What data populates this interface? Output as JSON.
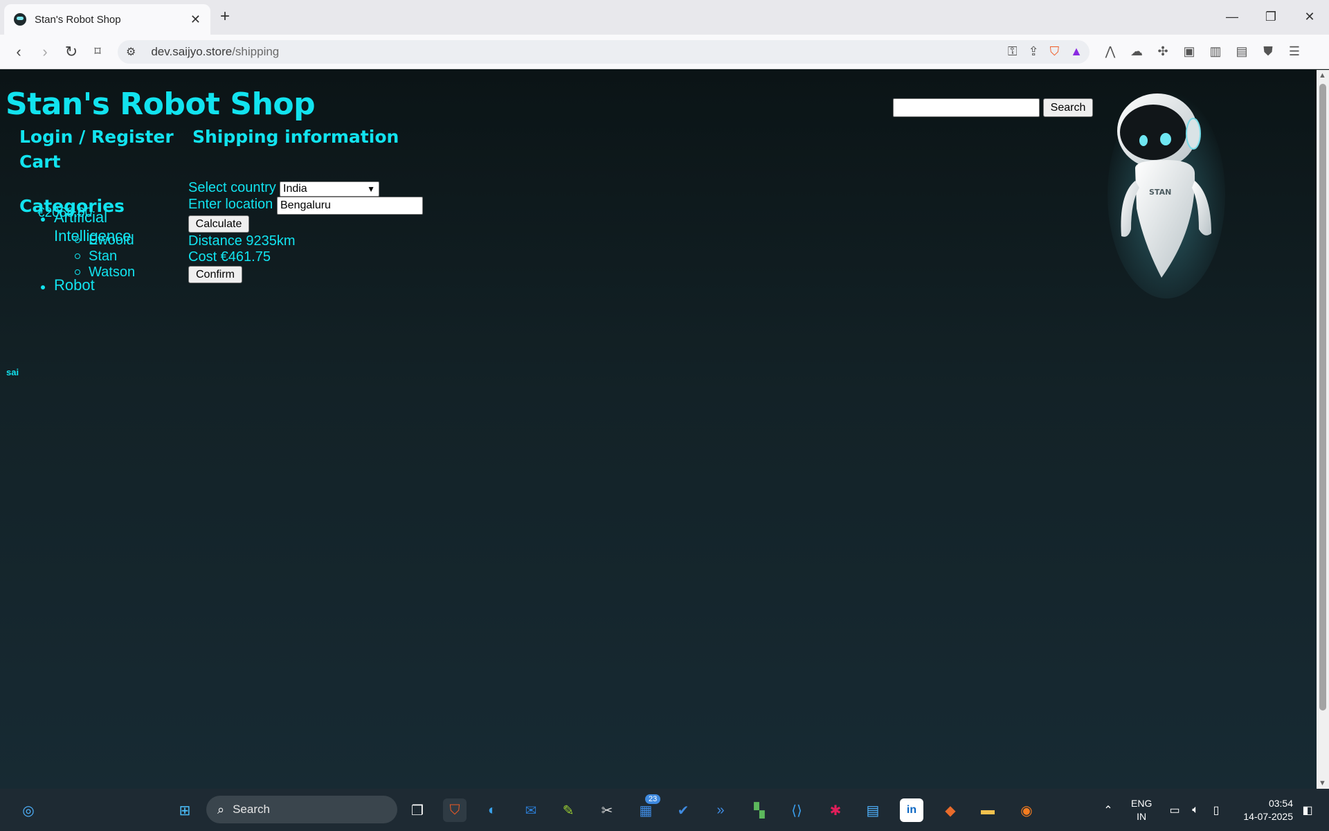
{
  "browser": {
    "tab_title": "Stan's Robot Shop",
    "url_host": "dev.saijyo.store",
    "url_path": "/shipping"
  },
  "header": {
    "shop_title": "Stan's Robot Shop",
    "search_placeholder": "",
    "search_button": "Search"
  },
  "sidebar": {
    "login_register": "Login / Register",
    "cart_heading": "Cart",
    "cart_total": "€2068.00",
    "categories_heading": "Categories",
    "categories": [
      {
        "label": "Artificial",
        "label2": "Intelligence",
        "items": [
          "Ewooid",
          "Stan",
          "Watson"
        ]
      },
      {
        "label": "Robot",
        "items": []
      }
    ]
  },
  "shipping": {
    "heading": "Shipping information",
    "country_label": "Select country",
    "country_value": "India",
    "location_label": "Enter location",
    "location_value": "Bengaluru",
    "calculate_button": "Calculate",
    "distance_text": "Distance 9235km",
    "cost_text": "Cost €461.75",
    "confirm_button": "Confirm"
  },
  "footer": {
    "user": "sai"
  },
  "robot_label": "STAN",
  "taskbar": {
    "search_text": "Search",
    "badge_count": "23",
    "lang_top": "ENG",
    "lang_bottom": "IN",
    "time": "03:54",
    "date": "14-07-2025"
  },
  "colors": {
    "accent": "#12e3ef",
    "page_bg_top": "#0b1416",
    "page_bg_bottom": "#172a33"
  }
}
